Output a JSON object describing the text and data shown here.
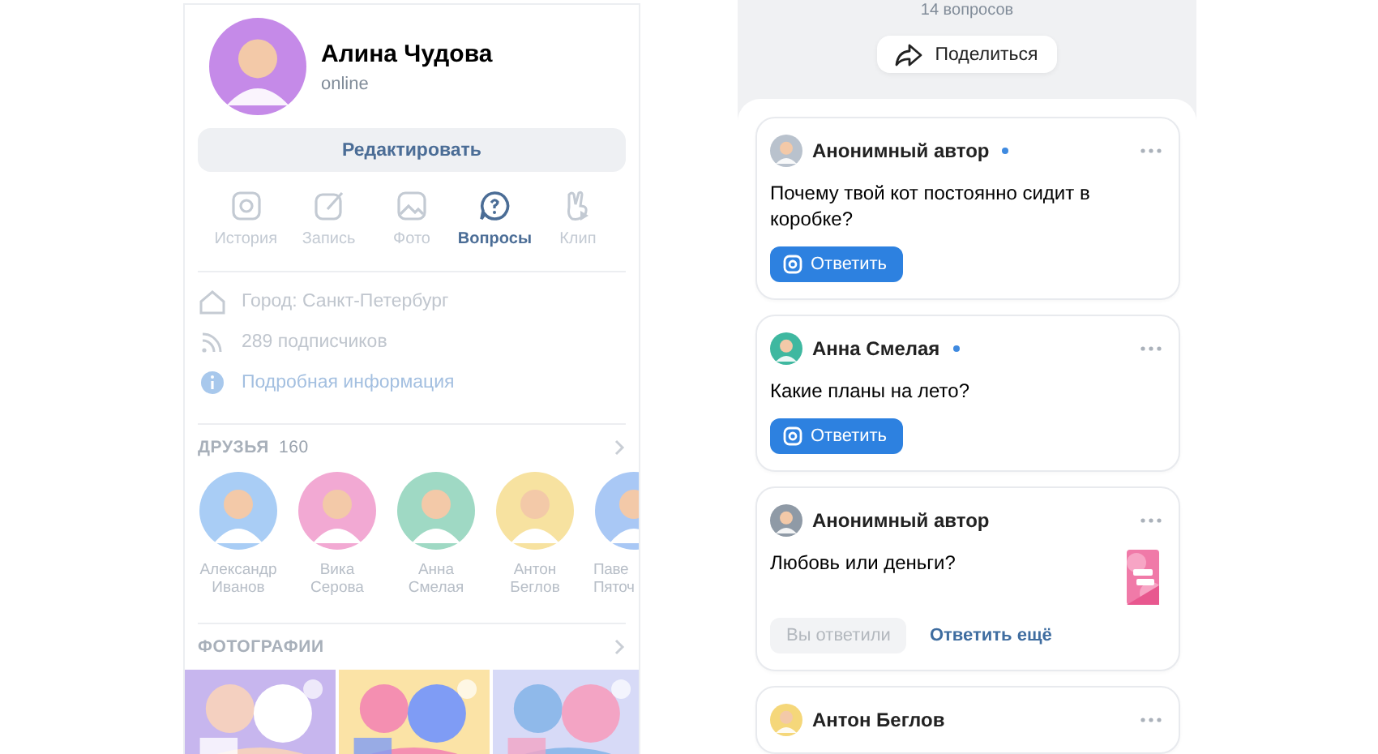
{
  "left": {
    "profile": {
      "name": "Алина Чудова",
      "status": "online"
    },
    "edit_button": "Редактировать",
    "tabs": [
      {
        "kind": "story",
        "label": "История",
        "selected": false
      },
      {
        "kind": "post",
        "label": "Запись",
        "selected": false
      },
      {
        "label": "Фото",
        "selected": false
      },
      {
        "kind": "questions",
        "label": "Вопросы",
        "selected": true
      },
      {
        "kind": "clip",
        "label": "Клип",
        "selected": false
      }
    ],
    "info": [
      {
        "kind": "city",
        "text": "Город: Санкт-Петербург"
      },
      {
        "kind": "followers",
        "text": "289 подписчиков"
      },
      {
        "kind": "details",
        "text": "Подробная информация"
      }
    ],
    "friends": {
      "title": "ДРУЗЬЯ",
      "count": "160",
      "items": [
        {
          "first": "Александр",
          "last": "Иванов",
          "color": "#a9cdf5"
        },
        {
          "first": "Вика",
          "last": "Серова",
          "color": "#f2a9d3"
        },
        {
          "first": "Анна",
          "last": "Смелая",
          "color": "#9fd9c4"
        },
        {
          "first": "Антон",
          "last": "Беглов",
          "color": "#f7e2a0"
        },
        {
          "first": "Паве",
          "last": "Пяточ",
          "color": "#a9c8f5"
        }
      ]
    },
    "photos": {
      "title": "ФОТОГРАФИИ"
    }
  },
  "right": {
    "count": "14 вопросов",
    "share_button": "Поделиться",
    "questions": [
      {
        "kind": "open",
        "author": "Анонимный автор",
        "color": "#b9c2cd",
        "unread": true,
        "text": "Почему твой кот постоянно сидит в коробке?",
        "answer_button": "Ответить"
      },
      {
        "kind": "open",
        "author": "Анна Смелая",
        "color": "#3fb8a0",
        "unread": true,
        "text": "Какие планы на лето?",
        "answer_button": "Ответить"
      },
      {
        "kind": "answered",
        "author": "Анонимный автор",
        "color": "#8f9aa6",
        "unread": false,
        "text": "Любовь или деньги?",
        "answered_label": "Вы ответили",
        "again_link": "Ответить ещё"
      },
      {
        "kind": "header",
        "author": "Антон Беглов",
        "color": "#f5d77a",
        "unread": false
      }
    ]
  }
}
